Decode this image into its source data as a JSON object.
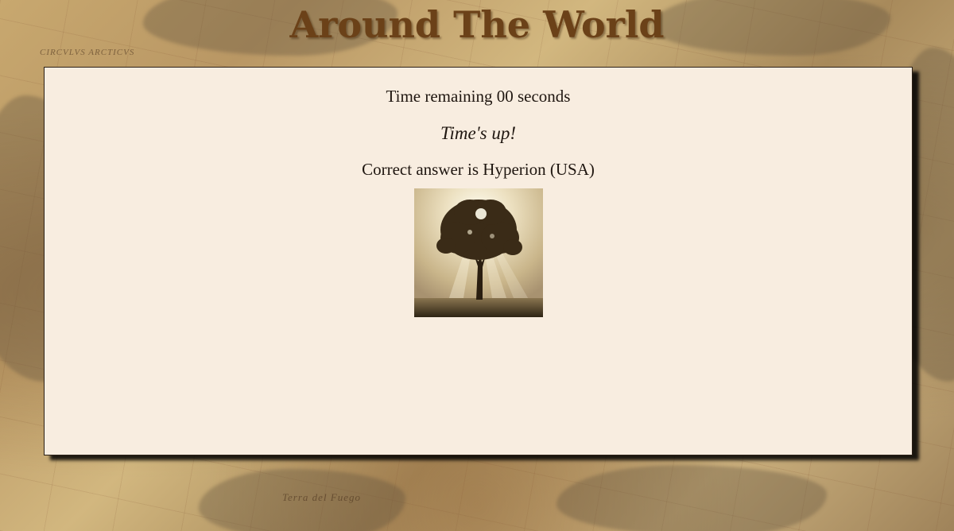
{
  "header": {
    "title": "Around The World"
  },
  "game": {
    "timer_text": "Time remaining 00 seconds",
    "status_text": "Time's up!",
    "answer_text": "Correct answer is Hyperion (USA)",
    "image": {
      "subject": "tree-silhouette-sunlight",
      "icon_name": "tree-photo"
    }
  },
  "map": {
    "labels": [
      "CIRCVLVS ARCTICVS",
      "Terra del Fuego"
    ]
  },
  "colors": {
    "title": "#6b4118",
    "panel_background": "#f8ede0",
    "panel_border": "#2b2016",
    "text": "#1f1610"
  }
}
